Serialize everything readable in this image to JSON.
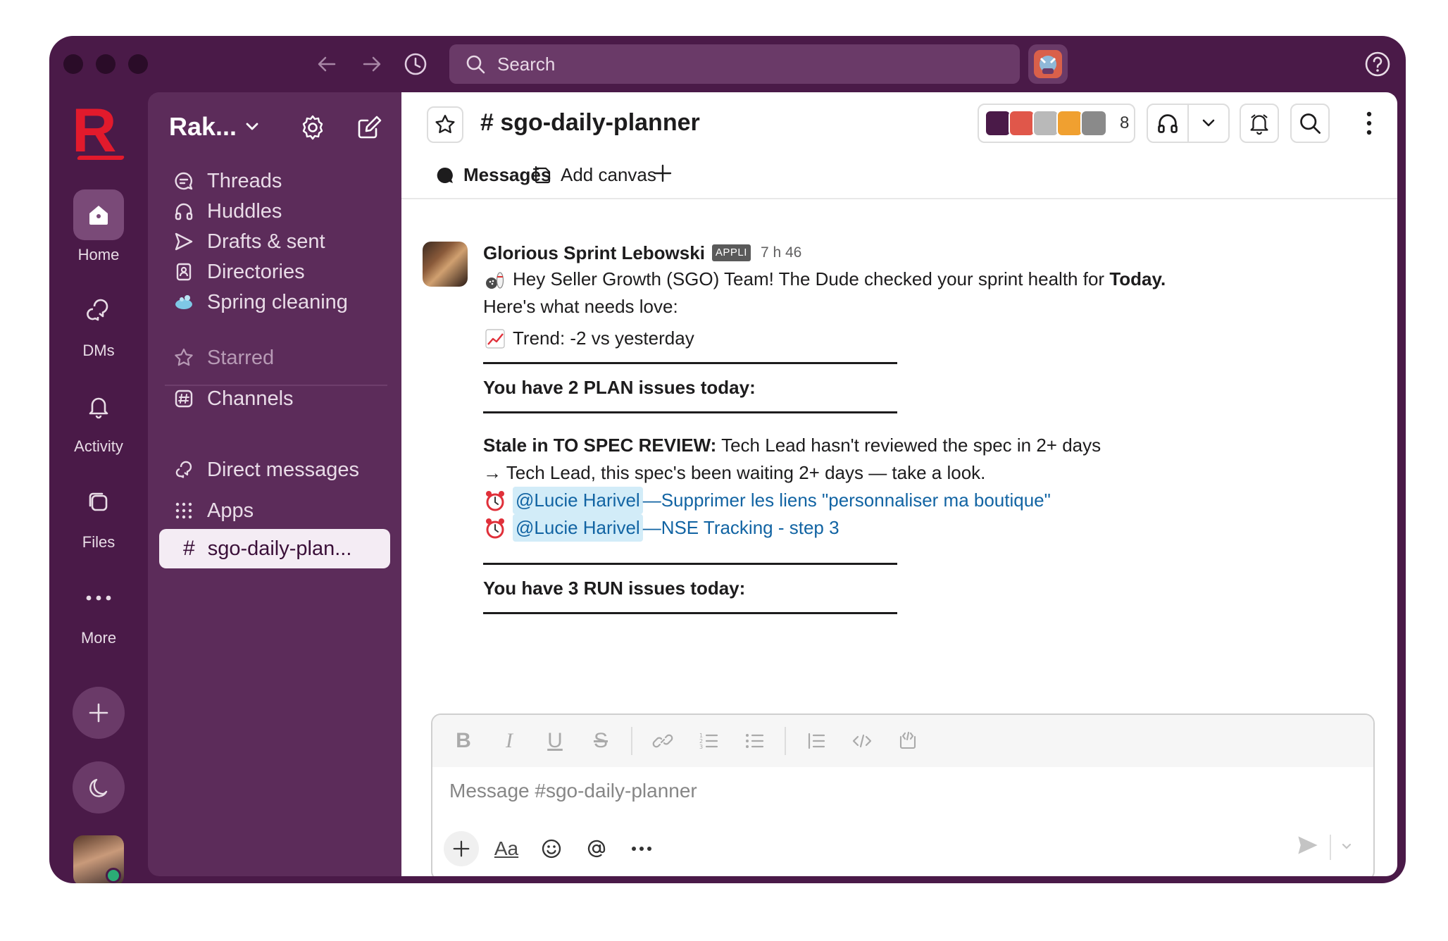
{
  "titlebar": {
    "search_placeholder": "Search"
  },
  "rail": {
    "logo": "R",
    "items": [
      {
        "label": "Home"
      },
      {
        "label": "DMs"
      },
      {
        "label": "Activity"
      },
      {
        "label": "Files"
      },
      {
        "label": "More"
      }
    ]
  },
  "sidebar": {
    "workspace_name": "Rak...",
    "items": [
      {
        "label": "Threads"
      },
      {
        "label": "Huddles"
      },
      {
        "label": "Drafts & sent"
      },
      {
        "label": "Directories"
      },
      {
        "label": "Spring cleaning"
      }
    ],
    "starred": "Starred",
    "channels": "Channels",
    "active_channel": "sgo-daily-plan...",
    "direct_messages": "Direct messages",
    "apps": "Apps"
  },
  "header": {
    "channel_title": "# sgo-daily-planner",
    "member_count": "8"
  },
  "tabs": [
    {
      "label": "Messages"
    },
    {
      "label": "Add canvas"
    }
  ],
  "message": {
    "author": "Glorious Sprint Lebowski",
    "badge": "APPLI",
    "time": "7 h 46",
    "intro": "Hey Seller Growth (SGO) Team! The Dude checked your sprint health for ",
    "intro_bold": "Today.",
    "needs_love": "Here's what needs love:",
    "trend": "Trend: -2 vs yesterday",
    "plan_heading": "You have 2 PLAN issues today:",
    "stale_bold": "Stale in TO SPEC REVIEW:",
    "stale_rest": " Tech Lead hasn't reviewed the spec in 2+ days",
    "arrow_line": "→ Tech Lead, this spec's been waiting 2+ days — take a look.",
    "issues": [
      {
        "mention": "@Lucie Harivel",
        "dash": " — ",
        "title": "Supprimer les liens \"personnaliser ma boutique\""
      },
      {
        "mention": "@Lucie Harivel",
        "dash": " — ",
        "title": "NSE Tracking - step 3"
      }
    ],
    "run_heading": "You have 3 RUN issues today:"
  },
  "composer": {
    "placeholder": "Message #sgo-daily-planner",
    "format_label": "Aa"
  },
  "colors": {
    "aubergine": "#4a1a48",
    "sidebar": "#5c2c5a",
    "link": "#1264a3",
    "mention_bg": "#d2ecf8",
    "logo_red": "#e21a2c"
  }
}
